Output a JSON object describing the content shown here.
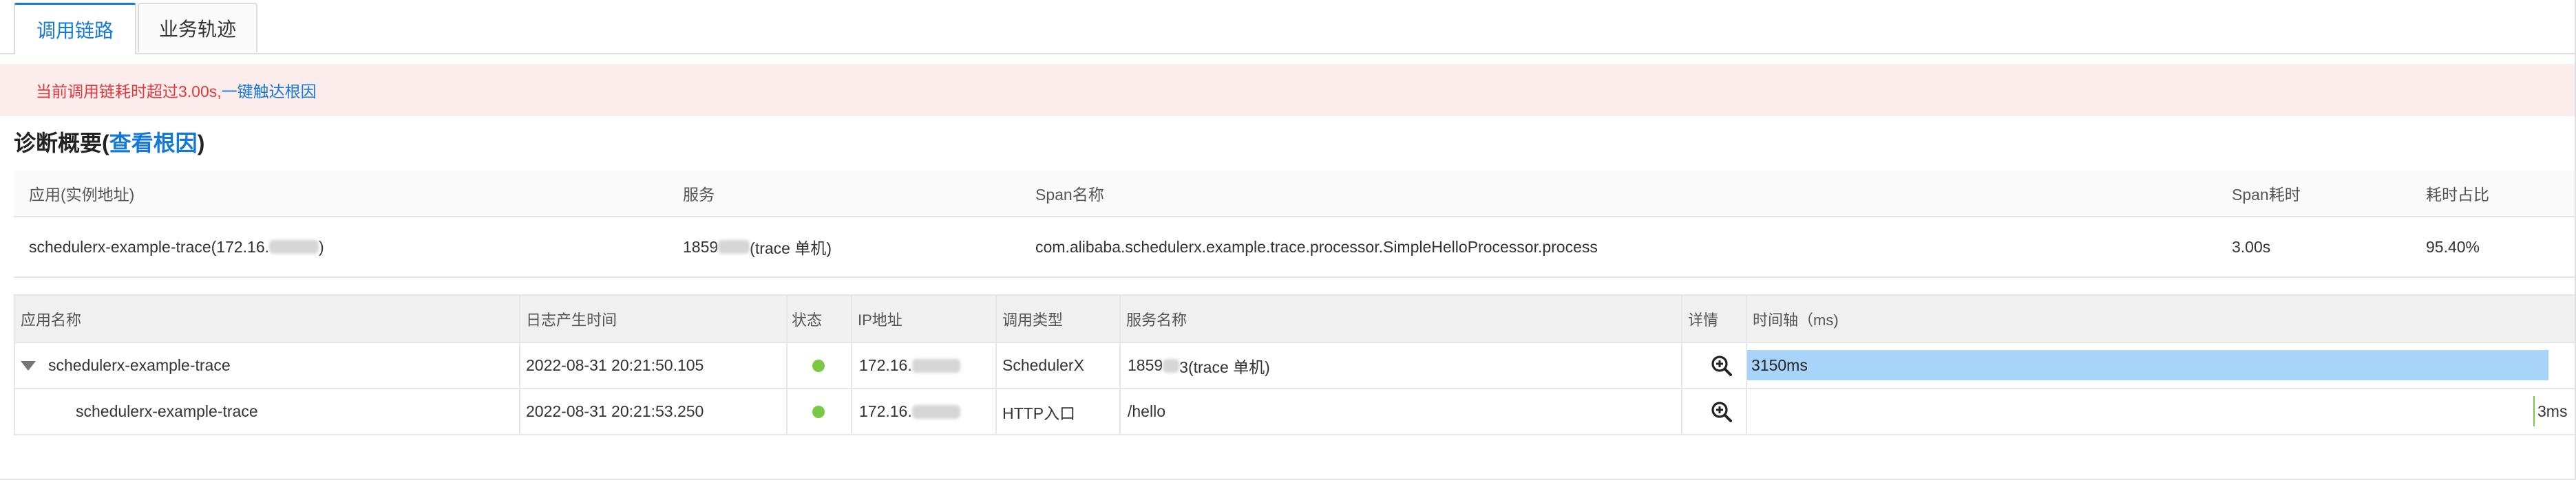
{
  "tabs": {
    "active": "调用链路",
    "inactive": "业务轨迹"
  },
  "alert": {
    "warning": "当前调用链耗时超过3.00s,",
    "link": "一键触达根因"
  },
  "summary": {
    "title_prefix": "诊断概要(",
    "title_link": "查看根因",
    "title_suffix": ")",
    "headers": {
      "app": "应用(实例地址)",
      "service": "服务",
      "span_name": "Span名称",
      "span_time": "Span耗时",
      "ratio": "耗时占比"
    },
    "row": {
      "app_prefix": "schedulerx-example-trace(172.16.",
      "app_suffix": ")",
      "service_prefix": "1859",
      "service_suffix": "(trace 单机)",
      "span_name": "com.alibaba.schedulerx.example.trace.processor.SimpleHelloProcessor.process",
      "span_time": "3.00s",
      "ratio": "95.40%"
    }
  },
  "trace": {
    "headers": {
      "app": "应用名称",
      "time": "日志产生时间",
      "status": "状态",
      "ip": "IP地址",
      "call_type": "调用类型",
      "service": "服务名称",
      "detail": "详情",
      "timeline": "时间轴（ms)"
    },
    "rows": [
      {
        "app": "schedulerx-example-trace",
        "time": "2022-08-31 20:21:50.105",
        "ip_prefix": "172.16.",
        "call_type": "SchedulerX",
        "service_prefix": "1859",
        "service_suffix": "3(trace 单机)",
        "duration": "3150ms",
        "fraction_start": 0.0,
        "fraction_width": 0.9796
      },
      {
        "app": "schedulerx-example-trace",
        "time": "2022-08-31 20:21:53.250",
        "ip_prefix": "172.16.",
        "call_type": "HTTP入口",
        "service_prefix": "/hello",
        "service_suffix": "",
        "duration": "3ms",
        "fraction_start": 0.9787,
        "fraction_width": 0.001
      }
    ]
  },
  "colors": {
    "accent": "#1479d7",
    "alert_bg": "#fdecec",
    "alert_text": "#e0393e",
    "bar": "#a8d4fa",
    "status_ok": "#7ac943"
  },
  "icons": {
    "expand": "caret-down-icon",
    "status": "status-dot-icon",
    "detail": "zoom-in-icon"
  }
}
